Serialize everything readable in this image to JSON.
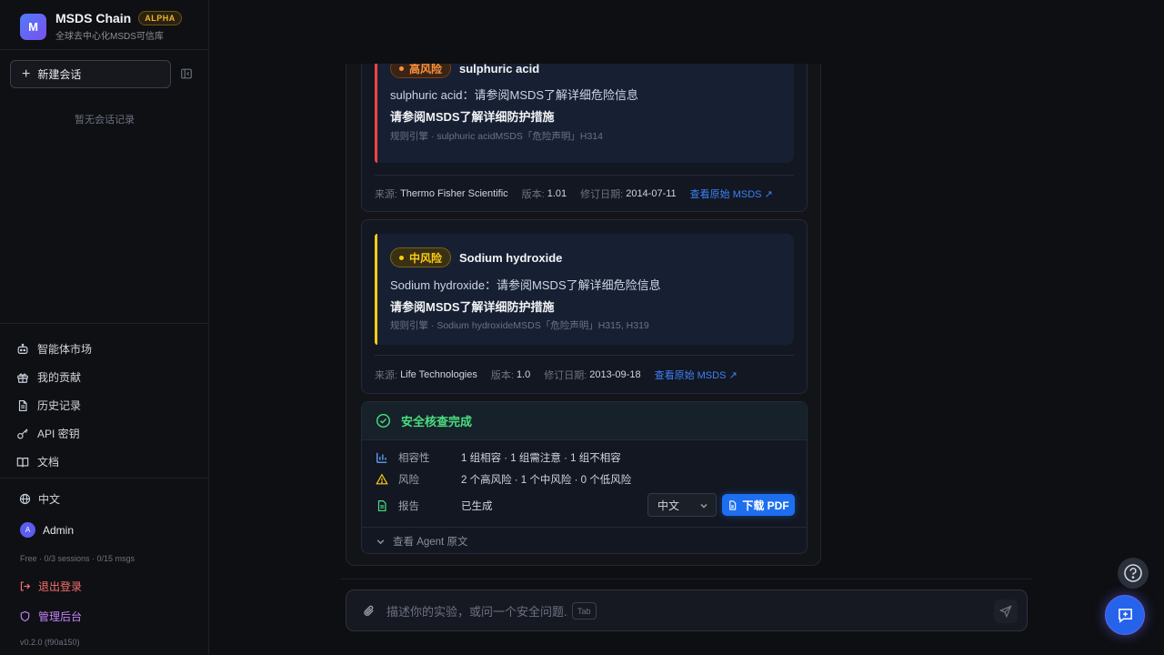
{
  "sidebar": {
    "logo_letter": "M",
    "app_title": "MSDS Chain",
    "alpha_badge": "ALPHA",
    "subtitle": "全球去中心化MSDS可信库",
    "new_chat": "新建会话",
    "empty_hint": "暂无会话记录",
    "nav": [
      {
        "label": "智能体市场",
        "icon": "robot-icon"
      },
      {
        "label": "我的贡献",
        "icon": "gift-icon"
      },
      {
        "label": "历史记录",
        "icon": "document-icon"
      },
      {
        "label": "API 密钥",
        "icon": "key-icon"
      },
      {
        "label": "文档",
        "icon": "book-icon"
      }
    ],
    "language": "中文",
    "user_initial": "A",
    "user_name": "Admin",
    "quota": "Free · 0/3 sessions · 0/15 msgs",
    "logout": "退出登录",
    "admin": "管理后台",
    "version": "v0.2.0 (f90a150)"
  },
  "cards": [
    {
      "risk_label": "高风险",
      "chemical": "sulphuric acid",
      "description": "sulphuric acid：请参阅MSDS了解详细危险信息",
      "measure": "请参阅MSDS了解详细防护措施",
      "rule": "规则引擎 · sulphuric acidMSDS「危险声明」H314",
      "source_label": "来源:",
      "source": "Thermo Fisher Scientific",
      "version_label": "版本:",
      "version": "1.01",
      "revised_label": "修订日期:",
      "revised": "2014-07-11",
      "link": "查看原始 MSDS ↗"
    },
    {
      "risk_label": "中风险",
      "chemical": "Sodium hydroxide",
      "description": "Sodium hydroxide：请参阅MSDS了解详细危险信息",
      "measure": "请参阅MSDS了解详细防护措施",
      "rule": "规则引擎 · Sodium hydroxideMSDS「危险声明」H315, H319",
      "source_label": "来源:",
      "source": "Life Technologies",
      "version_label": "版本:",
      "version": "1.0",
      "revised_label": "修订日期:",
      "revised": "2013-09-18",
      "link": "查看原始 MSDS ↗"
    }
  ],
  "summary": {
    "title": "安全核查完成",
    "rows": [
      {
        "label": "相容性",
        "value": "1 组相容 · 1 组需注意 · 1 组不相容"
      },
      {
        "label": "风险",
        "value": "2 个高风险 · 1 个中风险 · 0 个低风险"
      },
      {
        "label": "报告",
        "value": "已生成"
      }
    ],
    "language_select": "中文",
    "download_pdf": "下载 PDF",
    "raw_toggle": "查看 Agent 原文"
  },
  "composer": {
    "placeholder": "描述你的实验，或问一个安全问题...",
    "tab_hint": "Tab"
  },
  "colors": {
    "accent": "#1d6ff0",
    "high_risk": "#ef4444",
    "mid_risk": "#facc15",
    "success": "#4ade80"
  }
}
